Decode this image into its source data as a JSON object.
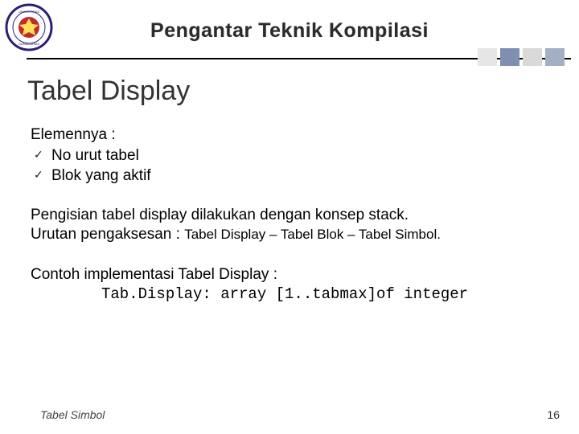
{
  "header": {
    "title": "Pengantar Teknik Kompilasi"
  },
  "slide": {
    "title": "Tabel Display"
  },
  "content": {
    "elements_heading": "Elemennya :",
    "items": [
      "No urut tabel",
      "Blok yang aktif"
    ],
    "para1_line1": "Pengisian tabel display dilakukan dengan konsep stack.",
    "para1_line2_lead": "Urutan pengaksesan : ",
    "para1_line2_tail": "Tabel Display – Tabel Blok – Tabel Simbol.",
    "impl_heading": "Contoh implementasi Tabel Display :",
    "code": "Tab.Display: array [1..tabmax]of integer"
  },
  "footer": {
    "left": "Tabel Simbol",
    "page": "16"
  }
}
